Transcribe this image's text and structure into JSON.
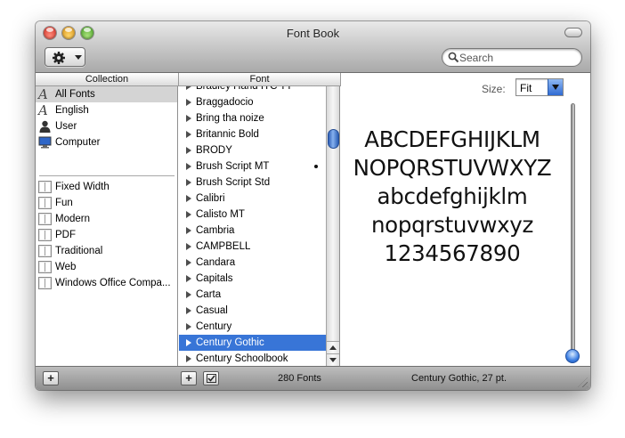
{
  "window": {
    "title": "Font Book"
  },
  "search": {
    "placeholder": "Search"
  },
  "columns": {
    "collection": "Collection",
    "font": "Font"
  },
  "collections": [
    {
      "label": "All Fonts",
      "icon": "font-a-icon",
      "selected": true
    },
    {
      "label": "English",
      "icon": "font-a-icon"
    },
    {
      "label": "User",
      "icon": "user-icon"
    },
    {
      "label": "Computer",
      "icon": "computer-icon"
    },
    {
      "label": "Fixed Width",
      "icon": "book-icon"
    },
    {
      "label": "Fun",
      "icon": "book-icon"
    },
    {
      "label": "Modern",
      "icon": "book-icon"
    },
    {
      "label": "PDF",
      "icon": "book-icon"
    },
    {
      "label": "Traditional",
      "icon": "book-icon"
    },
    {
      "label": "Web",
      "icon": "book-icon"
    },
    {
      "label": "Windows Office Compa...",
      "icon": "book-icon"
    }
  ],
  "fonts": [
    {
      "label": "Bradley Hand ITC TT"
    },
    {
      "label": "Braggadocio"
    },
    {
      "label": "Bring tha noize"
    },
    {
      "label": "Britannic Bold"
    },
    {
      "label": "BRODY"
    },
    {
      "label": "Brush Script MT",
      "marked": true
    },
    {
      "label": "Brush Script Std"
    },
    {
      "label": "Calibri"
    },
    {
      "label": "Calisto MT"
    },
    {
      "label": "Cambria"
    },
    {
      "label": "CAMPBELL"
    },
    {
      "label": "Candara"
    },
    {
      "label": "Capitals"
    },
    {
      "label": "Carta"
    },
    {
      "label": "Casual"
    },
    {
      "label": "Century"
    },
    {
      "label": "Century Gothic",
      "selected": true
    },
    {
      "label": "Century Schoolbook"
    }
  ],
  "preview": {
    "size_label": "Size:",
    "size_value": "Fit",
    "lines": [
      "ABCDEFGHIJKLM",
      "NOPQRSTUVWXYZ",
      "abcdefghijklm",
      "nopqrstuvwxyz",
      "1234567890"
    ]
  },
  "status": {
    "count": "280 Fonts",
    "current_font": "Century Gothic, 27 pt."
  },
  "colors": {
    "selection": "#3875d7",
    "collection_selection": "#d4d4d4"
  }
}
